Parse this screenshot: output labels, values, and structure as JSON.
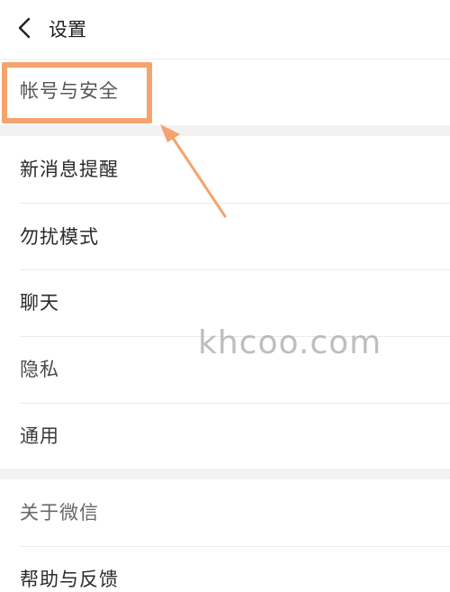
{
  "header": {
    "title": "设置"
  },
  "settings": {
    "items": [
      {
        "label": "帐号与安全"
      },
      {
        "label": "新消息提醒"
      },
      {
        "label": "勿扰模式"
      },
      {
        "label": "聊天"
      },
      {
        "label": "隐私"
      },
      {
        "label": "通用"
      },
      {
        "label": "关于微信"
      },
      {
        "label": "帮助与反馈"
      }
    ]
  },
  "overlay": {
    "highlight_color": "#f5a36e",
    "watermark_text": "khcoo.com"
  }
}
